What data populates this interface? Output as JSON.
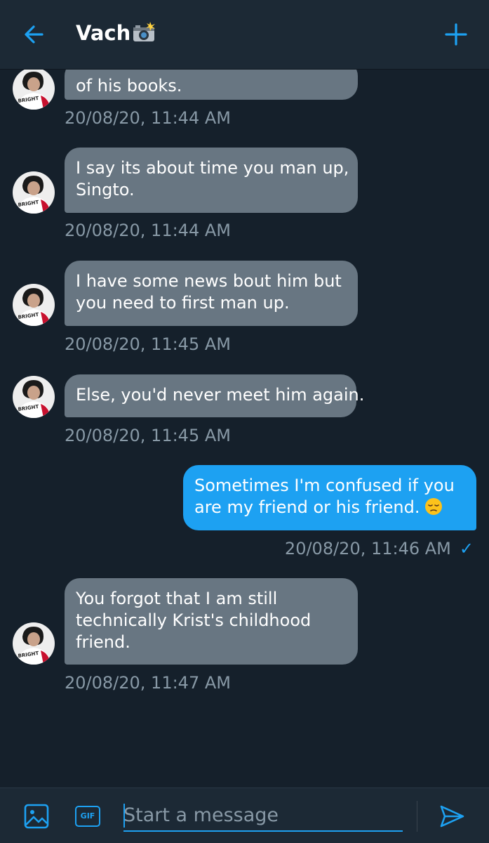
{
  "header": {
    "title": "Vach",
    "title_icon": "camera-flash-emoji",
    "back_icon": "arrow-left-icon",
    "add_icon": "plus-icon"
  },
  "messages": [
    {
      "direction": "in",
      "lines": [
        "of his books."
      ],
      "time": "20/08/20, 11:44 AM"
    },
    {
      "direction": "in",
      "lines": [
        "I say its about time you man up,",
        "Singto."
      ],
      "time": "20/08/20, 11:44 AM"
    },
    {
      "direction": "in",
      "lines": [
        "I have some news bout him but",
        "you need to first man up."
      ],
      "time": "20/08/20, 11:45 AM"
    },
    {
      "direction": "in",
      "lines": [
        "Else, you'd never meet him again."
      ],
      "time": "20/08/20, 11:45 AM"
    },
    {
      "direction": "out",
      "lines": [
        "Sometimes I'm confused if you",
        "are my friend or his friend."
      ],
      "emoji": "pensive-face-emoji",
      "time": "20/08/20, 11:46 AM",
      "status": "✓"
    },
    {
      "direction": "in",
      "lines": [
        "You forgot that I am still",
        "technically Krist's childhood",
        "friend."
      ],
      "time": "20/08/20, 11:47 AM"
    }
  ],
  "avatar_label": "BRIGHT",
  "composer": {
    "placeholder": "Start a message",
    "gif_label": "GIF",
    "media_icon": "image-icon",
    "send_icon": "send-icon"
  },
  "colors": {
    "background": "#15202b",
    "header": "#1c2935",
    "incoming_bubble": "#687682",
    "outgoing_bubble": "#1da1f2",
    "timestamp": "#8899a6",
    "accent": "#1da1f2"
  }
}
